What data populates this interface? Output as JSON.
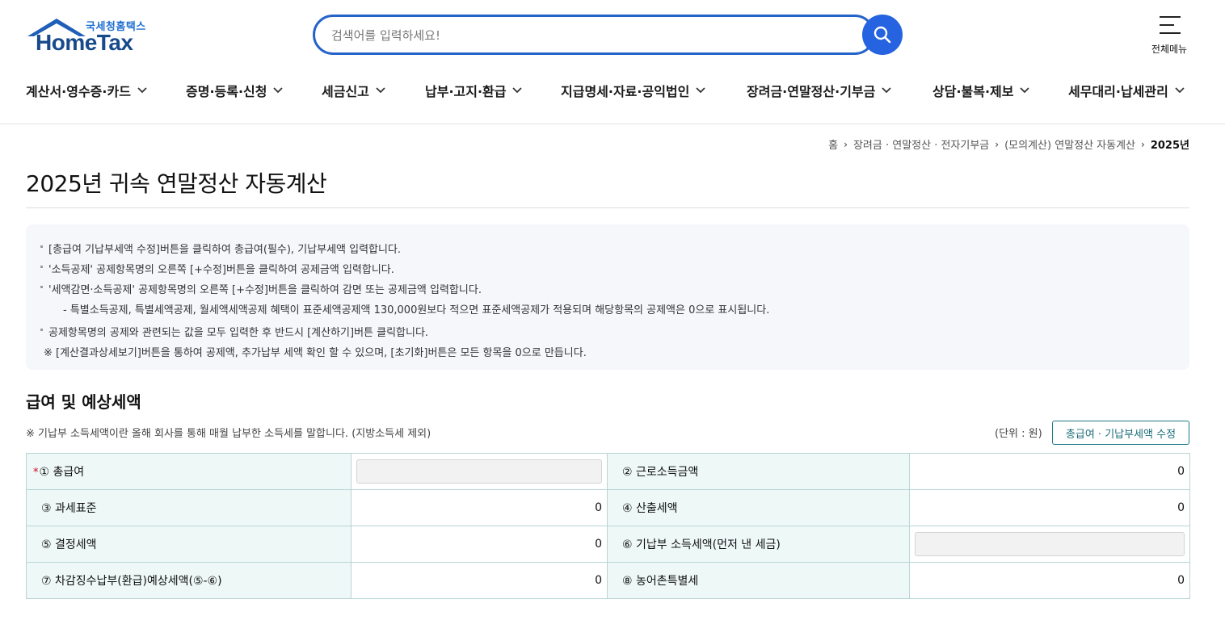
{
  "logo": {
    "sub": "국세청홈택스",
    "main": "HomeTax"
  },
  "search": {
    "placeholder": "검색어를 입력하세요!"
  },
  "menu_all": {
    "label": "전체메뉴"
  },
  "gnb": [
    {
      "label": "계산서·영수증·카드"
    },
    {
      "label": "증명·등록·신청"
    },
    {
      "label": "세금신고"
    },
    {
      "label": "납부·고지·환급"
    },
    {
      "label": "지급명세·자료·공익법인"
    },
    {
      "label": "장려금·연말정산·기부금"
    },
    {
      "label": "상담·불복·제보"
    },
    {
      "label": "세무대리·납세관리"
    }
  ],
  "breadcrumb": {
    "home": "홈",
    "level1": "장려금 · 연말정산 · 전자기부금",
    "level2": "(모의계산) 연말정산 자동계산",
    "current": "2025년"
  },
  "page_title": "2025년 귀속 연말정산 자동계산",
  "info": [
    "[총급여 기납부세액 수정]버튼을 클릭하여 총급여(필수), 기납부세액 입력합니다.",
    "'소득공제' 공제항목명의 오른쪽 [+수정]버튼을 클릭하여 공제금액 입력합니다.",
    "'세액감면·소득공제' 공제항목명의 오른쪽 [+수정]버튼을 클릭하여 감면 또는 공제금액 입력합니다.",
    "- 특별소득공제, 특별세액공제, 월세액세액공제 혜택이 표준세액공제액 130,000원보다 적으면 표준세액공제가 적용되며 해당항목의 공제액은 0으로 표시됩니다.",
    "공제항목명의 공제와 관련되는 값을 모두 입력한 후 반드시 [계산하기]버튼 클릭합니다.",
    "※ [계산결과상세보기]버튼을 통하여 공제액, 추가납부 세액 확인 할 수 있으며, [초기화]버튼은 모든 항목을 0으로 만듭니다."
  ],
  "section": {
    "title": "급여 및 예상세액",
    "note": "※ 기납부 소득세액이란 올해 회사를 통해 매월 납부한 소득세를 말합니다. (지방소득세 제외)",
    "unit": "(단위 : 원)",
    "edit_button": "총급여 · 기납부세액 수정"
  },
  "table": {
    "required_mark": "*",
    "rows": [
      {
        "l1": "① 총급여",
        "v1": "",
        "l2": "② 근로소득금액",
        "v2": "0"
      },
      {
        "l1": "③ 과세표준",
        "v1": "0",
        "l2": "④ 산출세액",
        "v2": "0"
      },
      {
        "l1": "⑤ 결정세액",
        "v1": "0",
        "l2": "⑥ 기납부 소득세액(먼저 낸 세금)",
        "v2": ""
      },
      {
        "l1": "⑦ 차감징수납부(환급)예상세액(⑤-⑥)",
        "v1": "0",
        "l2": "⑧ 농어촌특별세",
        "v2": "0"
      }
    ]
  },
  "colors": {
    "brand_blue": "#2563e0",
    "logo_navy": "#174a8b",
    "table_label_bg": "#eef8f7",
    "table_border": "#b9d5d5",
    "teal_button": "#1c7a85"
  }
}
